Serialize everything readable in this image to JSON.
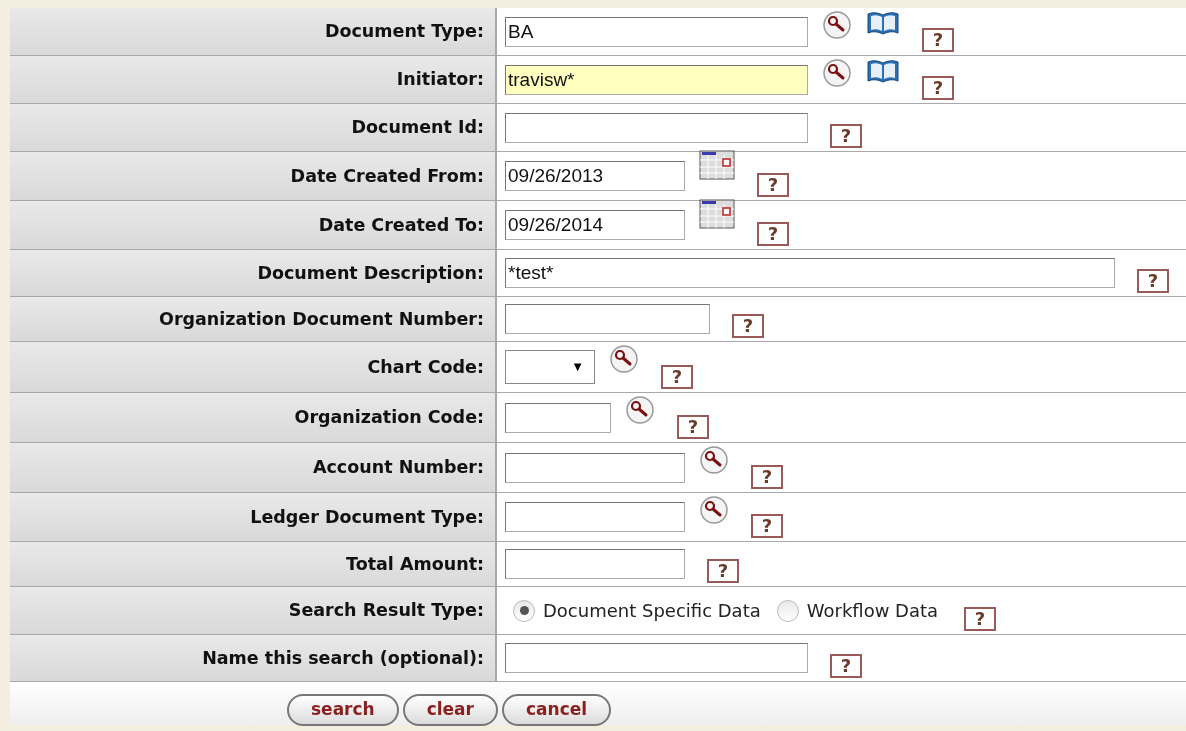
{
  "fields": [
    {
      "label": "Document Type:",
      "kind": "text",
      "value": "BA",
      "highlighted": false,
      "lookup": true,
      "directory": true,
      "calendar": false
    },
    {
      "label": "Initiator:",
      "kind": "text",
      "value": "travisw*",
      "highlighted": true,
      "lookup": true,
      "directory": true,
      "calendar": false
    },
    {
      "label": "Document Id:",
      "kind": "text",
      "highlighted": false,
      "lookup": false,
      "directory": false,
      "calendar": false
    },
    {
      "label": "Date Created From:",
      "kind": "text",
      "value": "09/26/2013",
      "highlighted": false,
      "lookup": false,
      "directory": false,
      "calendar": true
    },
    {
      "label": "Date Created To:",
      "kind": "text",
      "value": "09/26/2014",
      "highlighted": false,
      "lookup": false,
      "directory": false,
      "calendar": true
    },
    {
      "label": "Document Description:",
      "kind": "text",
      "value": "*test*",
      "highlighted": false,
      "lookup": false,
      "directory": false,
      "calendar": false
    },
    {
      "label": "Organization Document Number:",
      "kind": "text",
      "highlighted": false,
      "lookup": false,
      "directory": false,
      "calendar": false
    },
    {
      "label": "Chart Code:",
      "kind": "select",
      "arrow": "▼",
      "highlighted": false,
      "lookup": true,
      "directory": false,
      "calendar": false
    },
    {
      "label": "Organization Code:",
      "kind": "text",
      "highlighted": false,
      "lookup": true,
      "directory": false,
      "calendar": false
    },
    {
      "label": "Account Number:",
      "kind": "text",
      "highlighted": false,
      "lookup": true,
      "directory": false,
      "calendar": false
    },
    {
      "label": "Ledger Document Type:",
      "kind": "text",
      "highlighted": false,
      "lookup": true,
      "directory": false,
      "calendar": false
    },
    {
      "label": "Total Amount:",
      "kind": "text",
      "highlighted": false,
      "lookup": false,
      "directory": false,
      "calendar": false
    },
    {
      "label": "Search Result Type:",
      "kind": "radio",
      "options": [
        {
          "label": "Document Specific Data",
          "selected": true
        },
        {
          "label": "Workflow Data",
          "selected": false
        }
      ],
      "highlighted": false,
      "lookup": false,
      "directory": false,
      "calendar": false
    },
    {
      "label": "Name this search (optional):",
      "kind": "text",
      "highlighted": false,
      "lookup": false,
      "directory": false,
      "calendar": false
    }
  ],
  "help_mark": "?",
  "buttons": [
    "search",
    "clear",
    "cancel"
  ]
}
